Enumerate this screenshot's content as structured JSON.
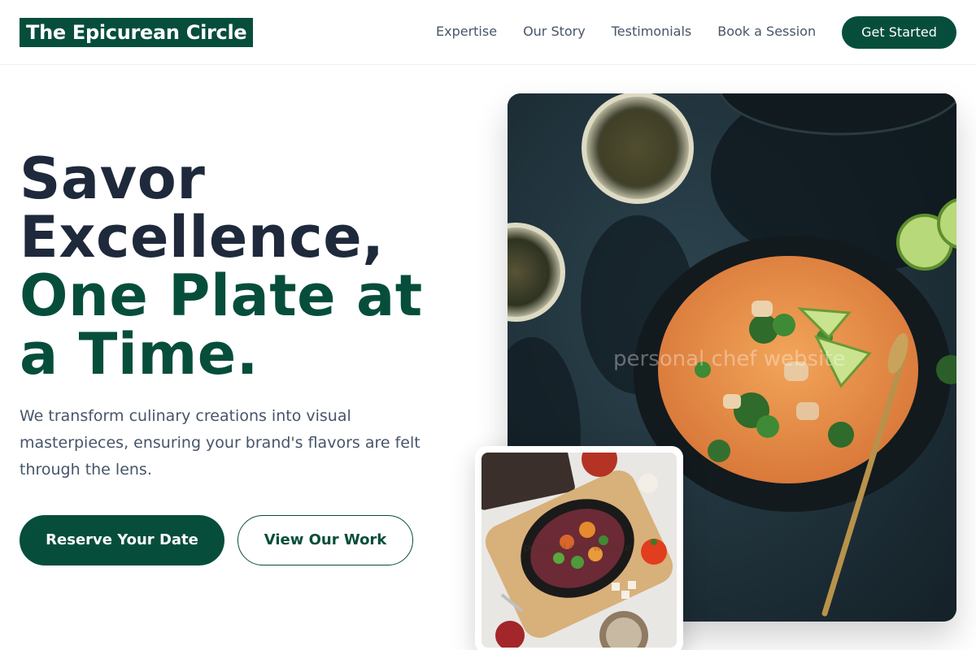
{
  "header": {
    "logo": "The Epicurean Circle",
    "nav": [
      "Expertise",
      "Our Story",
      "Testimonials",
      "Book a Session"
    ],
    "cta": "Get Started"
  },
  "hero": {
    "line1": "Savor",
    "line2": "Excellence,",
    "line3": "One Plate at",
    "line4": "a Time.",
    "subtitle": "We transform culinary creations into visual masterpieces, ensuring your brand's flavors are felt through the lens.",
    "primary_button": "Reserve Your Date",
    "secondary_button": "View Our Work"
  },
  "images": {
    "main_caption": "personal chef website",
    "small_caption": "personal chef website"
  },
  "colors": {
    "brand_green": "#064e3b",
    "heading_dark": "#1e293b",
    "body_text": "#475569"
  }
}
